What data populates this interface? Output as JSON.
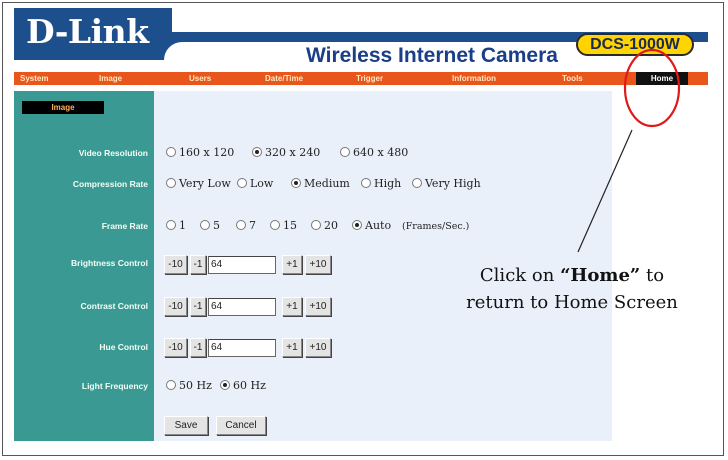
{
  "brand": {
    "logo": "D-Link",
    "product": "Wireless Internet Camera",
    "model": "DCS-1000W"
  },
  "nav": {
    "items": [
      "System",
      "Image",
      "Users",
      "Date/Time",
      "Trigger",
      "Information",
      "Tools"
    ],
    "home": "Home"
  },
  "section": {
    "title": "Image"
  },
  "rows": {
    "video_resolution": {
      "label": "Video Resolution",
      "options": [
        "160 x 120",
        "320 x 240",
        "640 x 480"
      ],
      "selected": "320 x 240"
    },
    "compression_rate": {
      "label": "Compression Rate",
      "options": [
        "Very Low",
        "Low",
        "Medium",
        "High",
        "Very High"
      ],
      "selected": "Medium"
    },
    "frame_rate": {
      "label": "Frame Rate",
      "options": [
        "1",
        "5",
        "7",
        "15",
        "20",
        "Auto"
      ],
      "selected": "Auto",
      "unit": "(Frames/Sec.)"
    },
    "brightness": {
      "label": "Brightness Control",
      "value": "64"
    },
    "contrast": {
      "label": "Contrast Control",
      "value": "64"
    },
    "hue": {
      "label": "Hue Control",
      "value": "64"
    },
    "light_frequency": {
      "label": "Light Frequency",
      "options": [
        "50 Hz",
        "60 Hz"
      ],
      "selected": "60 Hz"
    }
  },
  "controls": {
    "minus10": "-10",
    "minus1": "-1",
    "plus1": "+1",
    "plus10": "+10"
  },
  "buttons": {
    "save": "Save",
    "cancel": "Cancel"
  },
  "annotation": {
    "prefix": "Click on ",
    "highlight": "“Home”",
    "suffix": " to",
    "line2": "return to Home Screen",
    "circle_color": "#e01818"
  }
}
